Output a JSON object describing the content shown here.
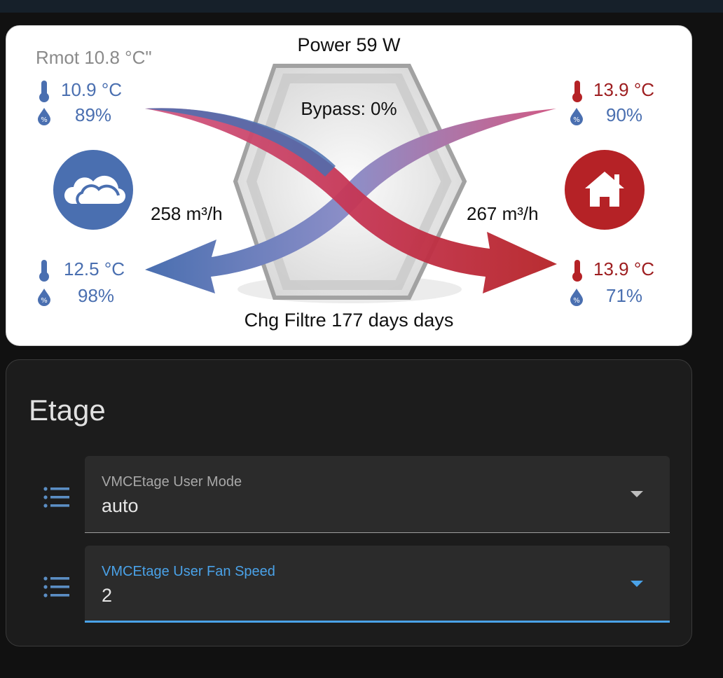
{
  "flow_card": {
    "power": "Power 59 W",
    "bypass": "Bypass: 0%",
    "filter": "Chg Filtre 177 days days",
    "remote_temp": "Rmot 10.8 °C\"",
    "outdoor_in": {
      "temp": "10.9 °C",
      "humidity": "89%"
    },
    "exhaust_out": {
      "temp": "12.5 °C",
      "humidity": "98%"
    },
    "indoor_extract": {
      "temp": "13.9 °C",
      "humidity": "90%"
    },
    "supply_in": {
      "temp": "13.9 °C",
      "humidity": "71%"
    },
    "exhaust_flow": "258 m³/h",
    "supply_flow": "267 m³/h",
    "colors": {
      "cold": "#4a6fb0",
      "warm": "#b52226",
      "mix": "#d05a85"
    },
    "icons": [
      "thermometer-icon",
      "humidity-drop-icon",
      "cloud-icon",
      "home-icon"
    ]
  },
  "etage_card": {
    "title": "Etage",
    "selects": [
      {
        "label": "VMCEtage User Mode",
        "value": "auto",
        "icon": "list-icon"
      },
      {
        "label": "VMCEtage User Fan Speed",
        "value": "2",
        "icon": "list-icon"
      }
    ],
    "accent": "#4aa2e8"
  }
}
